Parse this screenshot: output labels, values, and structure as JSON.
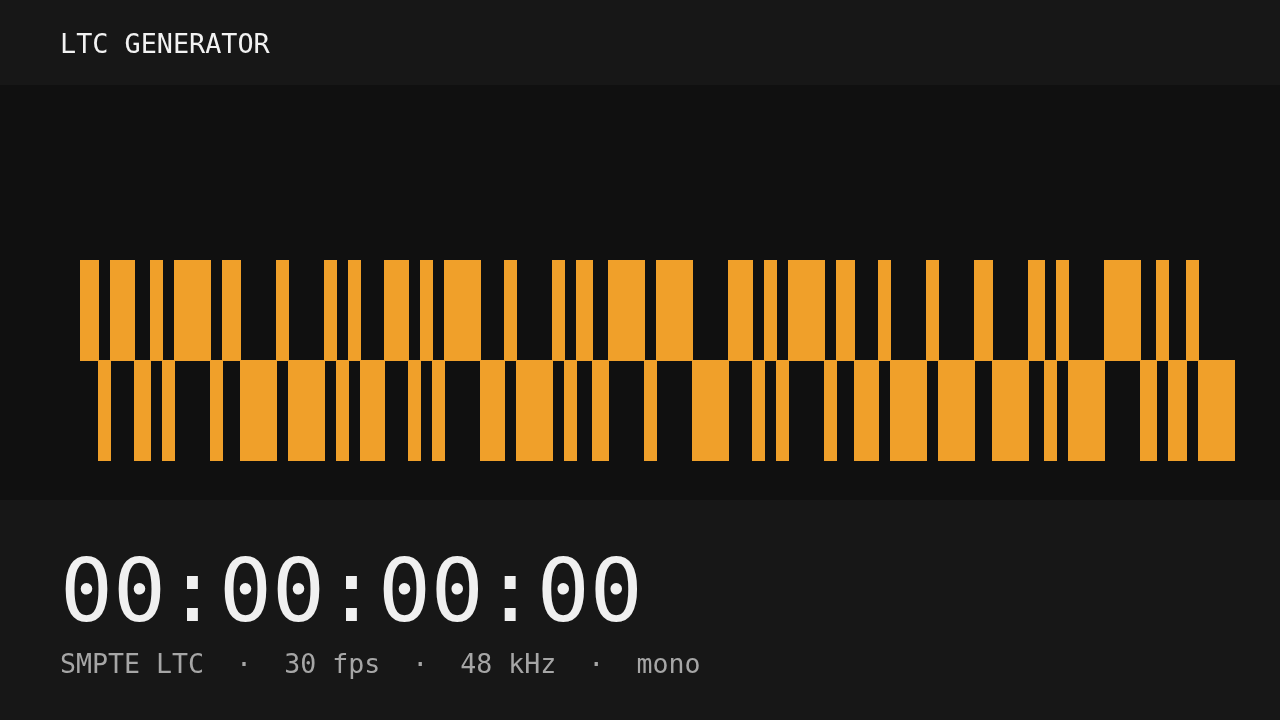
{
  "header": {
    "title": "LTC GENERATOR"
  },
  "timecode": "00:00:00:00",
  "signal_info": "SMPTE LTC  ·  30 fps  ·  48 kHz  ·  mono"
}
